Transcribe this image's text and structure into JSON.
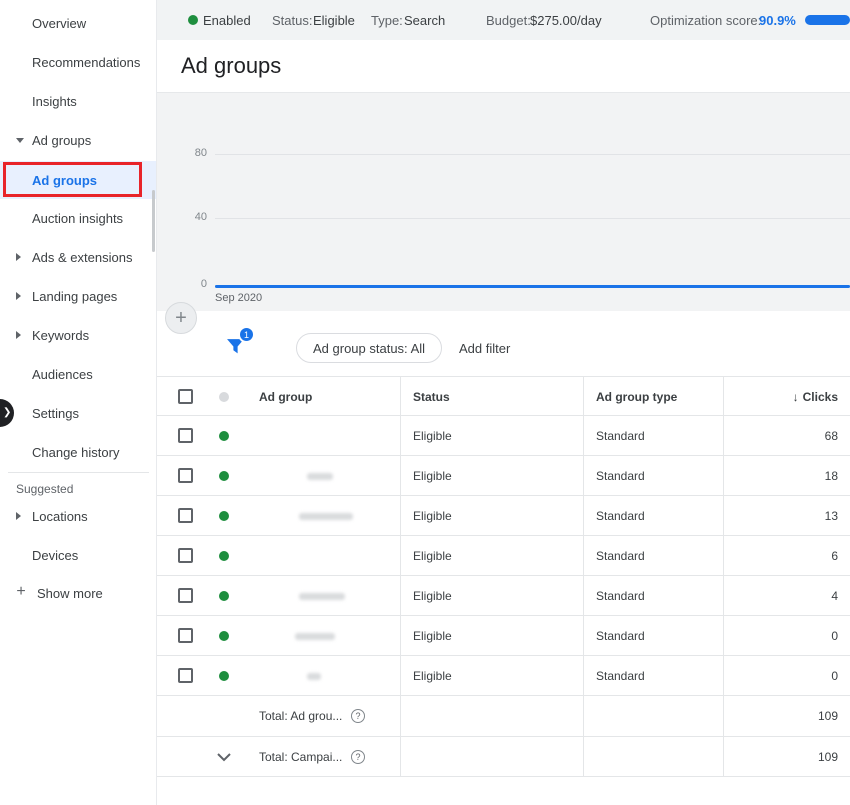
{
  "icons": {
    "plus": "+",
    "help": "?",
    "sort_desc": "↓",
    "chevron_right": "❯"
  },
  "colors": {
    "accent_blue": "#1a73e8",
    "enabled_green": "#1e8e3e",
    "annotation_red": "#e8242a"
  },
  "topbar": {
    "enabled": "Enabled",
    "status_label": "Status:",
    "status_value": "Eligible",
    "type_label": "Type:",
    "type_value": "Search",
    "budget_label": "Budget:",
    "budget_value": "$275.00/day",
    "optimization_label": "Optimization score:",
    "optimization_value": "90.9%"
  },
  "page": {
    "title": "Ad groups"
  },
  "sidebar": {
    "items": [
      {
        "label": "Overview"
      },
      {
        "label": "Recommendations"
      },
      {
        "label": "Insights"
      },
      {
        "label": "Ad groups"
      },
      {
        "label": "Ad groups"
      },
      {
        "label": "Auction insights"
      },
      {
        "label": "Ads & extensions"
      },
      {
        "label": "Landing pages"
      },
      {
        "label": "Keywords"
      },
      {
        "label": "Audiences"
      },
      {
        "label": "Settings"
      },
      {
        "label": "Change history"
      },
      {
        "label": "Suggested"
      },
      {
        "label": "Locations"
      },
      {
        "label": "Devices"
      },
      {
        "label": "Show more"
      }
    ]
  },
  "chart_data": {
    "type": "line",
    "yticks": [
      "80",
      "40",
      "0"
    ],
    "xticks": [
      "Sep 2020"
    ],
    "grid": true,
    "series": [
      {
        "name": "Clicks",
        "color": "#1a73e8",
        "shape": "flat line near zero"
      }
    ]
  },
  "filterbar": {
    "badge_count": "1",
    "status_chip": "Ad group status: All",
    "add_filter": "Add filter"
  },
  "table": {
    "columns": {
      "ad_group": "Ad group",
      "status": "Status",
      "type": "Ad group type",
      "clicks": "Clicks"
    },
    "rows": [
      {
        "status": "Eligible",
        "type": "Standard",
        "clicks": "68"
      },
      {
        "status": "Eligible",
        "type": "Standard",
        "clicks": "18"
      },
      {
        "status": "Eligible",
        "type": "Standard",
        "clicks": "13"
      },
      {
        "status": "Eligible",
        "type": "Standard",
        "clicks": "6"
      },
      {
        "status": "Eligible",
        "type": "Standard",
        "clicks": "4"
      },
      {
        "status": "Eligible",
        "type": "Standard",
        "clicks": "0"
      },
      {
        "status": "Eligible",
        "type": "Standard",
        "clicks": "0"
      }
    ],
    "totals": [
      {
        "label": "Total: Ad grou...",
        "clicks": "109"
      },
      {
        "label": "Total: Campai...",
        "clicks": "109"
      }
    ]
  }
}
